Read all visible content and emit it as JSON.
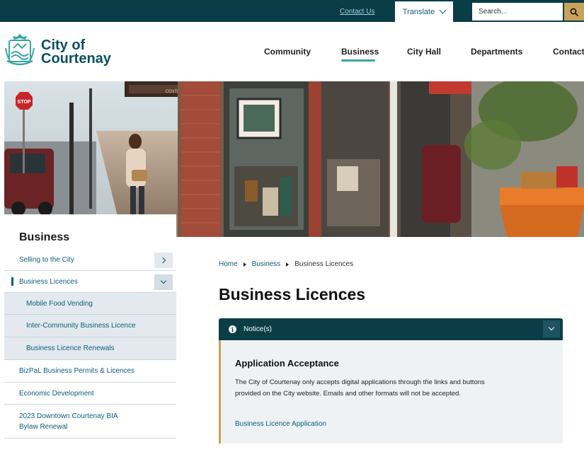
{
  "topbar": {
    "contact_label": "Contact Us",
    "translate_label": "Translate",
    "search_placeholder": "Search..."
  },
  "header": {
    "logo_line1": "City of",
    "logo_line2": "Courtenay",
    "nav": [
      {
        "label": "Community"
      },
      {
        "label": "Business"
      },
      {
        "label": "City Hall"
      },
      {
        "label": "Departments"
      },
      {
        "label": "Contact"
      }
    ]
  },
  "hero": {
    "sign_stop": "STOP",
    "sign_centre": "CENTRE"
  },
  "sidebar": {
    "title": "Business",
    "items": [
      {
        "label": "Selling to the City"
      },
      {
        "label": "Business Licences"
      },
      {
        "label": "Mobile Food Vending"
      },
      {
        "label": "Inter-Community Business Licence"
      },
      {
        "label": "Business Licence Renewals"
      },
      {
        "label": "BizPaL Business Permits & Licences"
      },
      {
        "label": "Economic Development"
      },
      {
        "label": "2023 Downtown Courtenay BIA"
      },
      {
        "label": "Bylaw Renewal"
      }
    ]
  },
  "breadcrumb": {
    "home": "Home",
    "business": "Business",
    "current": "Business Licences"
  },
  "main": {
    "title": "Business Licences",
    "notice": {
      "label": "Notice(s)",
      "heading": "Application Acceptance",
      "text": "The City of Courtenay only accepts digital applications through the links and buttons provided on the City website. Emails and other formats will not be accepted.",
      "link": "Business Licence Application"
    }
  },
  "colors": {
    "dark_teal": "#0b3d47",
    "link_blue": "#0b5e7a",
    "gold": "#c9a25a",
    "accent_teal": "#3aa6a0"
  }
}
